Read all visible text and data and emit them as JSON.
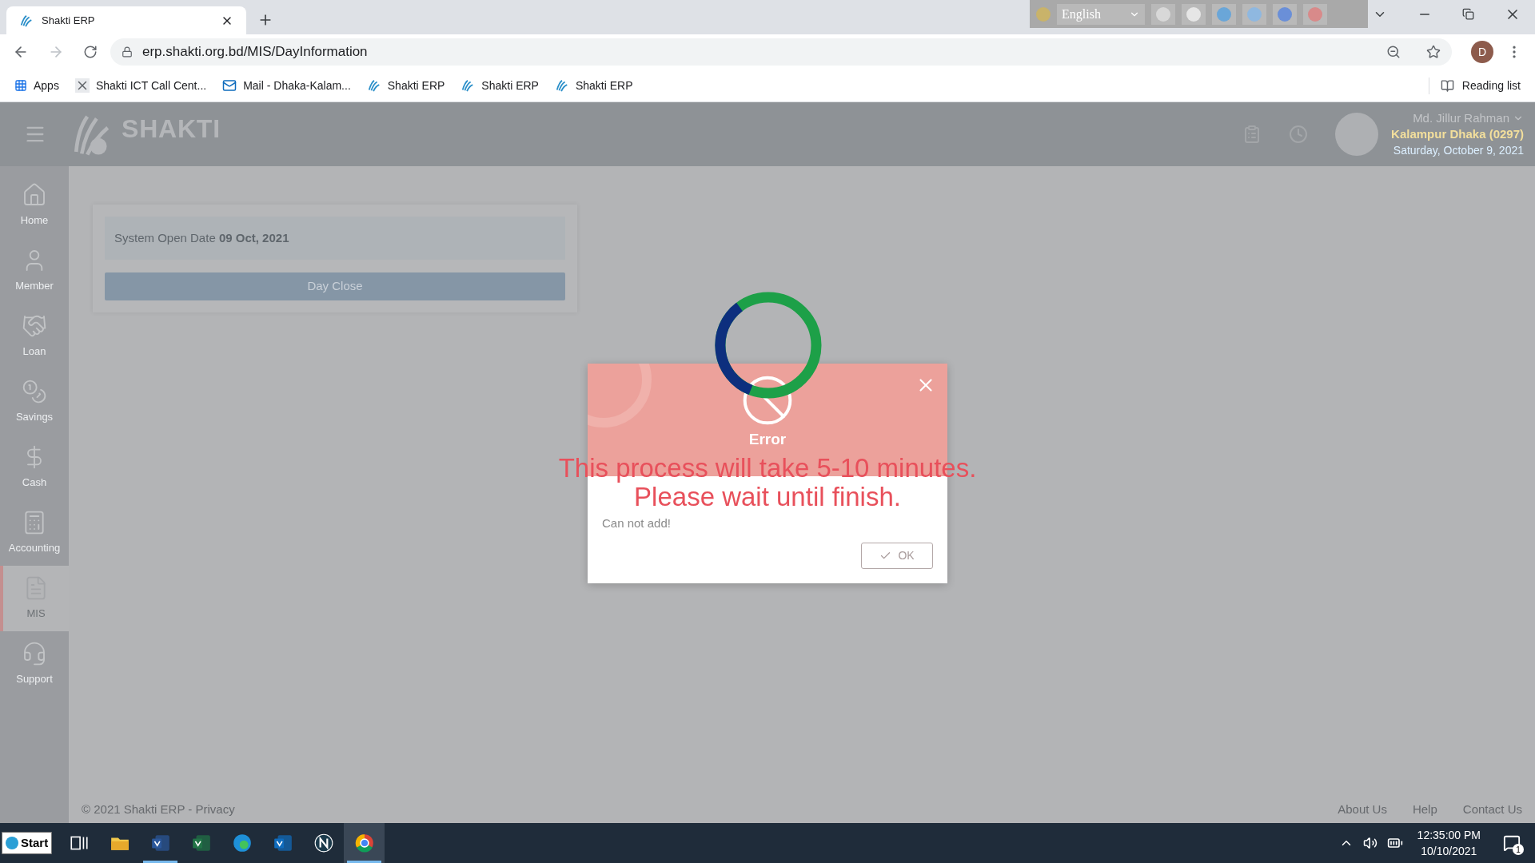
{
  "browser": {
    "tabs": [
      {
        "title": "Shakti ERP",
        "selected": true
      }
    ],
    "extension": {
      "language": "English"
    },
    "address": "erp.shakti.org.bd/MIS/DayInformation",
    "profile_initial": "D",
    "bookmarks": [
      {
        "label": "Apps"
      },
      {
        "label": "Shakti ICT Call Cent..."
      },
      {
        "label": "Mail - Dhaka-Kalam..."
      },
      {
        "label": "Shakti ERP"
      },
      {
        "label": "Shakti ERP"
      },
      {
        "label": "Shakti ERP"
      }
    ],
    "reading_list": "Reading list"
  },
  "header": {
    "logo": "SHAKTI",
    "user_name": "Md. Jillur Rahman",
    "branch": "Kalampur Dhaka (0297)",
    "date": "Saturday, October 9, 2021"
  },
  "sidebar": {
    "items": [
      {
        "label": "Home",
        "selected": false
      },
      {
        "label": "Member",
        "selected": false
      },
      {
        "label": "Loan",
        "selected": false
      },
      {
        "label": "Savings",
        "selected": false
      },
      {
        "label": "Cash",
        "selected": false
      },
      {
        "label": "Accounting",
        "selected": false
      },
      {
        "label": "MIS",
        "selected": true
      },
      {
        "label": "Support",
        "selected": false
      }
    ]
  },
  "content": {
    "system_open_date": "System Open Date **09 Oct, 2021**",
    "day_close_button": "Day Close"
  },
  "dialog": {
    "title": "Error",
    "message": "Can not add!",
    "ok_button": "OK"
  },
  "loading": {
    "lines": [
      "This process will take 5-10 minutes.",
      "Please wait until finish."
    ]
  },
  "footer": {
    "copyright": "© 2021 Shakti ERP - ",
    "privacy_link": "Privacy",
    "links": [
      "About Us",
      "Help",
      "Contact Us"
    ]
  },
  "taskbar": {
    "start": "Start",
    "apps": [
      {
        "running": false,
        "selected": false
      },
      {
        "running": false,
        "selected": false
      },
      {
        "running": true,
        "selected": false
      },
      {
        "running": false,
        "selected": false
      },
      {
        "running": false,
        "selected": false
      },
      {
        "running": false,
        "selected": false
      },
      {
        "running": false,
        "selected": false
      },
      {
        "running": true,
        "selected": true
      }
    ],
    "time": "12:35:00 PM",
    "date": "10/10/2021",
    "notifications": "1"
  }
}
